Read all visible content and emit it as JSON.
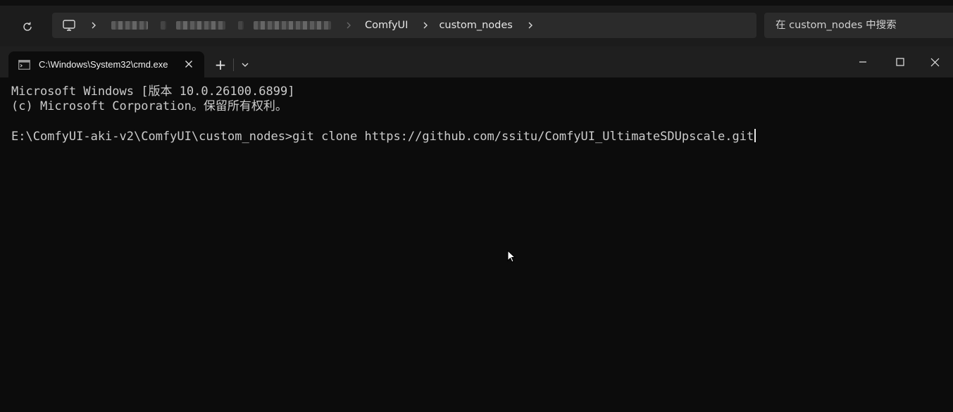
{
  "explorer": {
    "breadcrumbs": [
      "ComfyUI",
      "custom_nodes"
    ],
    "search_placeholder": "在 custom_nodes 中搜索"
  },
  "terminal": {
    "tab_title": "C:\\Windows\\System32\\cmd.exe",
    "new_tab_glyph": "+",
    "lines": [
      "Microsoft Windows [版本 10.0.26100.6899]",
      "(c) Microsoft Corporation。保留所有权利。",
      "",
      "E:\\ComfyUI-aki-v2\\ComfyUI\\custom_nodes>git clone https://github.com/ssitu/ComfyUI_UltimateSDUpscale.git"
    ]
  },
  "icons": {
    "refresh": "refresh-icon",
    "computer": "monitor-icon",
    "chevron": "chevron-right-icon",
    "terminal_app": "cmd-icon",
    "close": "close-icon",
    "dropdown": "chevron-down-icon",
    "minimize": "minimize-icon",
    "maximize": "maximize-icon"
  },
  "colors": {
    "console_bg": "#0c0c0c",
    "console_text": "#cccccc",
    "titlebar_bg": "#1f1f1f",
    "explorer_bg": "#1c1c1c"
  }
}
